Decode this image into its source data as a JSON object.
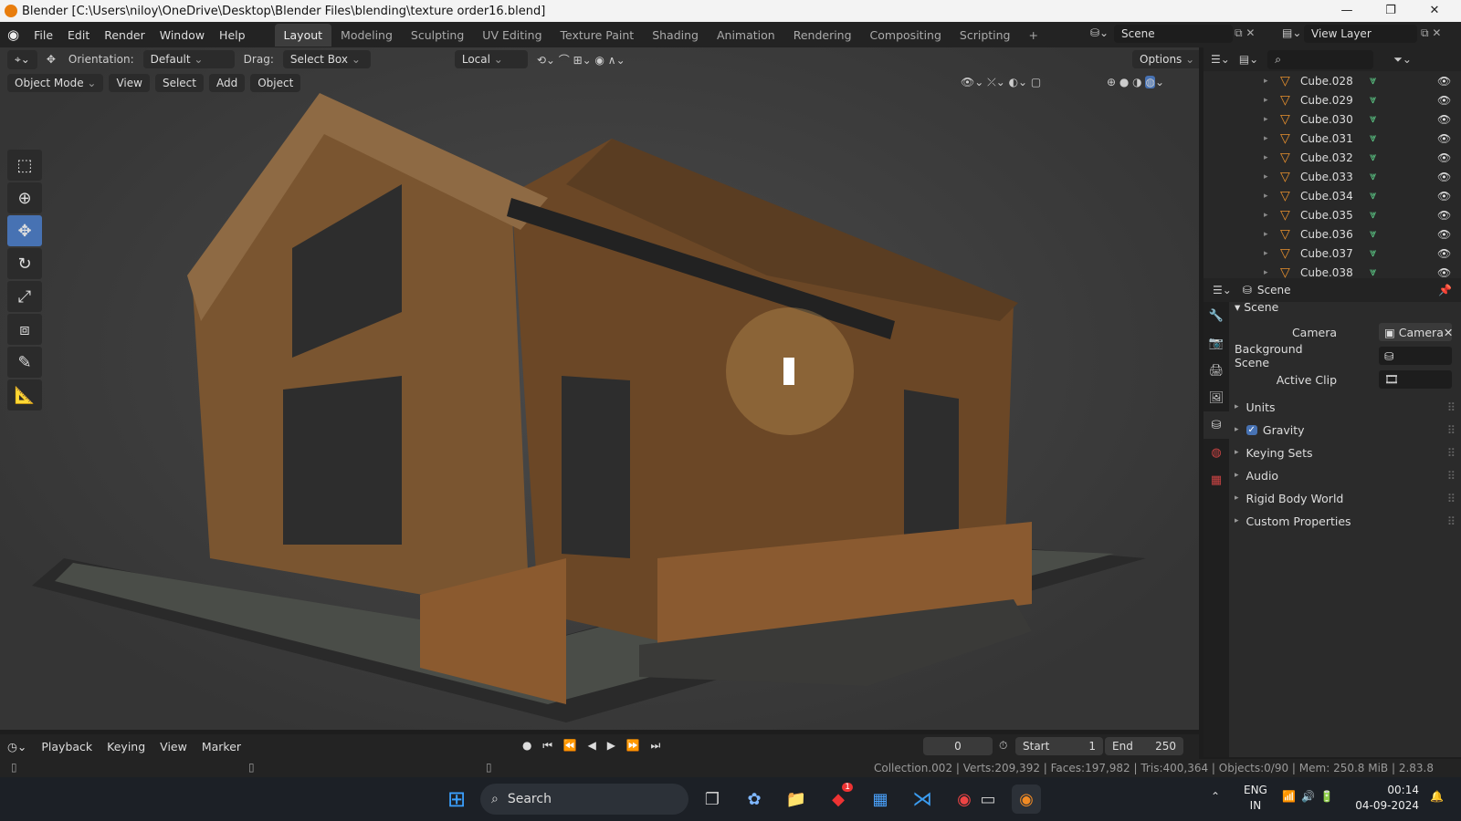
{
  "window": {
    "title": "Blender [C:\\Users\\niloy\\OneDrive\\Desktop\\Blender Files\\blending\\texture order16.blend]"
  },
  "menu": [
    "File",
    "Edit",
    "Render",
    "Window",
    "Help"
  ],
  "workspaces": [
    "Layout",
    "Modeling",
    "Sculpting",
    "UV Editing",
    "Texture Paint",
    "Shading",
    "Animation",
    "Rendering",
    "Compositing",
    "Scripting"
  ],
  "scene_label": "Scene",
  "view_layer_label": "View Layer",
  "tool_header": {
    "orientation_label": "Orientation:",
    "orientation_value": "Default",
    "drag_label": "Drag:",
    "drag_value": "Select Box",
    "pivot": "Local",
    "options": "Options"
  },
  "viewport_header": {
    "mode": "Object Mode",
    "menus": [
      "View",
      "Select",
      "Add",
      "Object"
    ]
  },
  "outliner": {
    "items": [
      "Cube.028",
      "Cube.029",
      "Cube.030",
      "Cube.031",
      "Cube.032",
      "Cube.033",
      "Cube.034",
      "Cube.035",
      "Cube.036",
      "Cube.037",
      "Cube.038"
    ]
  },
  "properties": {
    "header": "Scene",
    "section": "Scene",
    "camera_label": "Camera",
    "camera_value": "Camera",
    "background_scene_label": "Background Scene",
    "active_clip_label": "Active Clip",
    "panels": [
      "Units",
      "Gravity",
      "Keying Sets",
      "Audio",
      "Rigid Body World",
      "Custom Properties"
    ]
  },
  "timeline": {
    "menus": [
      "Playback",
      "Keying",
      "View",
      "Marker"
    ],
    "current_frame": "0",
    "start_label": "Start",
    "start": "1",
    "end_label": "End",
    "end": "250"
  },
  "status": "Collection.002 | Verts:209,392 | Faces:197,982 | Tris:400,364 | Objects:0/90 | Mem: 250.8 MiB | 2.83.8",
  "taskbar": {
    "search": "Search",
    "lang1": "ENG",
    "lang2": "IN",
    "time": "00:14",
    "date": "04-09-2024",
    "badge": "1"
  }
}
